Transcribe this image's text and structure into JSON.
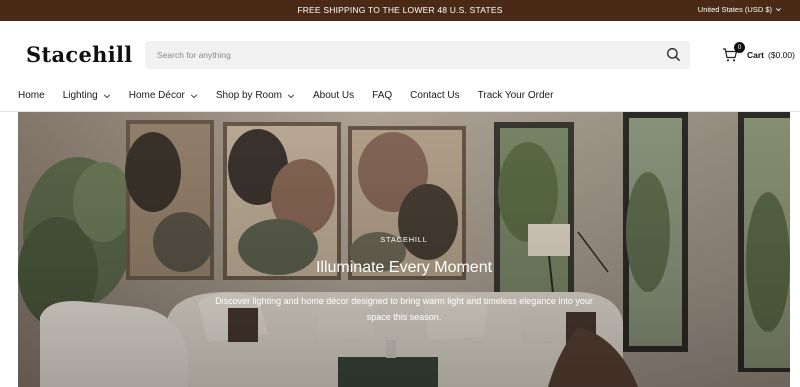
{
  "announcement": {
    "message": "FREE SHIPPING TO THE LOWER 48 U.S. STATES",
    "region": "United States (USD $)",
    "background": "#4a2a16"
  },
  "header": {
    "logo": "Stacehill",
    "search": {
      "placeholder": "Search for anything",
      "value": "",
      "icon": "search-icon"
    },
    "cart": {
      "count": "0",
      "label": "Cart",
      "amount": "($0.00)",
      "icon": "shopping-bag-icon"
    }
  },
  "nav": {
    "items": [
      {
        "label": "Home",
        "has_dropdown": false
      },
      {
        "label": "Lighting",
        "has_dropdown": true
      },
      {
        "label": "Home Décor",
        "has_dropdown": true
      },
      {
        "label": "Shop by Room",
        "has_dropdown": true
      },
      {
        "label": "About Us",
        "has_dropdown": false
      },
      {
        "label": "FAQ",
        "has_dropdown": false
      },
      {
        "label": "Contact Us",
        "has_dropdown": false
      },
      {
        "label": "Track Your Order",
        "has_dropdown": false
      }
    ]
  },
  "hero": {
    "eyebrow": "STACEHILL",
    "headline": "Illuminate Every Moment",
    "subtext": "Discover lighting and home décor designed to bring warm light and timeless elegance into your space this season.",
    "image": "living-room-photo"
  }
}
